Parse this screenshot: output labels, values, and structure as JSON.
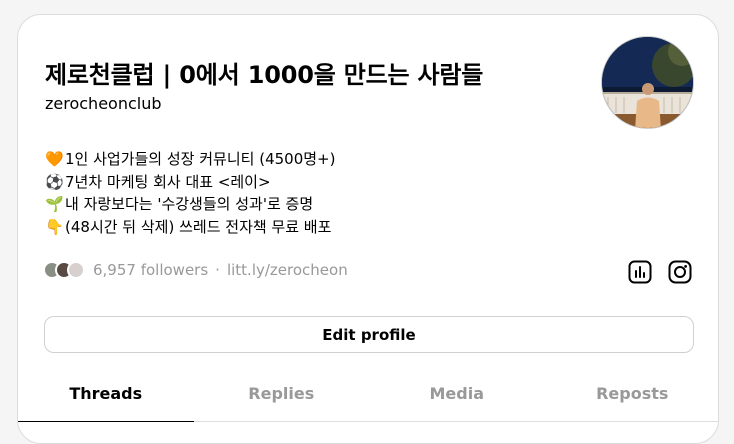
{
  "profile": {
    "name": "제로천클럽 | 0에서 1000을 만드는 사람들",
    "handle": "zerocheonclub",
    "bio": [
      {
        "emoji": "🧡",
        "text": "1인 사업가들의 성장 커뮤니티 (4500명+)"
      },
      {
        "emoji": "⚽",
        "text": "7년차 마케팅 회사 대표 <레이>"
      },
      {
        "emoji": "🌱",
        "text": "내 자랑보다는 '수강생들의 성과'로 증명"
      },
      {
        "emoji": "👇",
        "text": "(48시간 뒤 삭제) 쓰레드 전자책 무료 배포"
      }
    ],
    "followers": "6,957 followers",
    "link": "litt.ly/zerocheon"
  },
  "actions": {
    "edit_label": "Edit profile"
  },
  "icons": {
    "insights": "bar-chart-icon",
    "instagram": "instagram-icon"
  },
  "tabs": [
    {
      "label": "Threads",
      "active": true
    },
    {
      "label": "Replies",
      "active": false
    },
    {
      "label": "Media",
      "active": false
    },
    {
      "label": "Reposts",
      "active": false
    }
  ]
}
